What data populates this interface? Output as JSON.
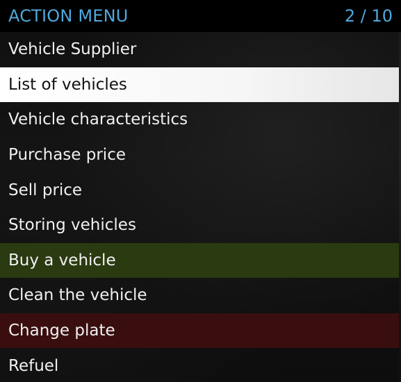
{
  "header": {
    "title": "ACTION MENU",
    "counter": "2 / 10"
  },
  "items": [
    {
      "label": "Vehicle Supplier",
      "style": "normal"
    },
    {
      "label": "List of vehicles",
      "style": "selected"
    },
    {
      "label": "Vehicle characteristics",
      "style": "normal"
    },
    {
      "label": "Purchase price",
      "style": "normal"
    },
    {
      "label": "Sell price",
      "style": "normal"
    },
    {
      "label": "Storing vehicles",
      "style": "normal"
    },
    {
      "label": "Buy a vehicle",
      "style": "green"
    },
    {
      "label": "Clean the vehicle",
      "style": "normal"
    },
    {
      "label": "Change plate",
      "style": "red"
    },
    {
      "label": "Refuel",
      "style": "normal"
    }
  ],
  "colors": {
    "title": "#4fa8dc",
    "selected_bg": "#ffffff",
    "green_bg": "#2a3a11",
    "red_bg": "#3a0e0e"
  }
}
